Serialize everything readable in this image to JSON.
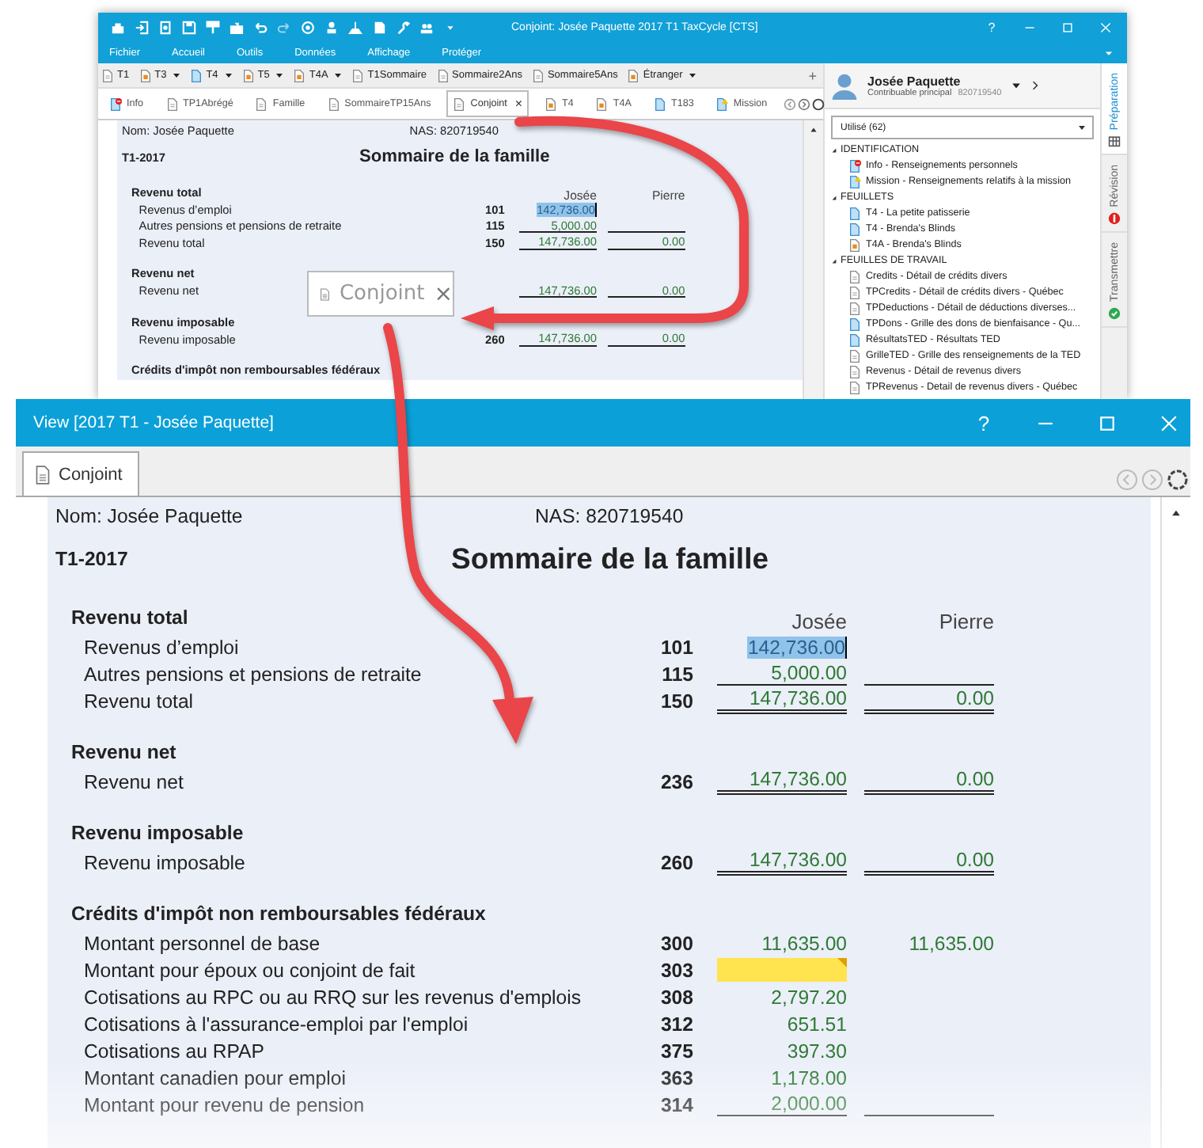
{
  "back_window": {
    "title": "Conjoint: Josée Paquette 2017 T1 TaxCycle [CTS]",
    "help": "?",
    "menu": [
      "Fichier",
      "Accueil",
      "Outils",
      "Données",
      "Affichage",
      "Protéger"
    ],
    "doc_tabs": [
      {
        "label": "T1",
        "kind": "plain",
        "dropdown": false
      },
      {
        "label": "T3",
        "kind": "orange",
        "dropdown": true
      },
      {
        "label": "T4",
        "kind": "blue",
        "dropdown": true
      },
      {
        "label": "T5",
        "kind": "orange",
        "dropdown": true
      },
      {
        "label": "T4A",
        "kind": "orange",
        "dropdown": true
      },
      {
        "label": "T1Sommaire",
        "kind": "plain",
        "dropdown": false
      },
      {
        "label": "Sommaire2Ans",
        "kind": "plain",
        "dropdown": false
      },
      {
        "label": "Sommaire5Ans",
        "kind": "plain",
        "dropdown": false
      },
      {
        "label": "Étranger",
        "kind": "orange",
        "dropdown": true
      }
    ],
    "add_tab": "+",
    "form_tabs": [
      {
        "label": "Info",
        "kind": "error",
        "selected": false
      },
      {
        "label": "TP1Abrégé",
        "kind": "plain",
        "selected": false
      },
      {
        "label": "Famille",
        "kind": "plain",
        "selected": false
      },
      {
        "label": "SommaireTP15Ans",
        "kind": "plain",
        "selected": false
      },
      {
        "label": "Conjoint",
        "kind": "plain",
        "selected": true,
        "close": "×"
      },
      {
        "label": "T4",
        "kind": "orange",
        "selected": false
      },
      {
        "label": "T4A",
        "kind": "orange",
        "selected": false
      },
      {
        "label": "T183",
        "kind": "blue",
        "selected": false
      },
      {
        "label": "Mission",
        "kind": "warning",
        "selected": false
      }
    ],
    "form": {
      "name": "Nom: Josée Paquette",
      "sin": "NAS: 820719540",
      "year": "T1-2017",
      "title": "Sommaire de la famille",
      "rows": [
        {
          "kind": "section",
          "label": "Revenu total",
          "columns": [
            "Josée",
            "Pierre"
          ]
        },
        {
          "kind": "line",
          "label": "Revenus d’emploi",
          "code": "101",
          "josee": "142,736.00",
          "underlined": false,
          "selected": true,
          "flagged": false
        },
        {
          "kind": "line",
          "label": "Autres pensions et pensions de retraite",
          "code": "115",
          "josee": "5,000.00",
          "underlined": true,
          "selected": false,
          "flagged": false
        },
        {
          "kind": "line",
          "label": "Revenu total",
          "code": "150",
          "josee": "147,736.00",
          "pierre": "0.00",
          "double": true,
          "selected": false,
          "flagged": false
        },
        {
          "kind": "section",
          "label": "Revenu net"
        },
        {
          "kind": "line",
          "label": "Revenu net",
          "josee": "147,736.00",
          "pierre": "0.00",
          "double": true,
          "selected": false,
          "flagged": false
        },
        {
          "kind": "section",
          "label": "Revenu imposable"
        },
        {
          "kind": "line",
          "label": "Revenu imposable",
          "code": "260",
          "josee": "147,736.00",
          "pierre": "0.00",
          "double": true,
          "selected": false,
          "flagged": false
        },
        {
          "kind": "section",
          "label": "Crédits d'impôt non remboursables fédéraux"
        }
      ]
    }
  },
  "side_panel": {
    "name": "Josée Paquette",
    "role": "Contribuable principal",
    "sin": "820719540",
    "filter": "Utilisé (62)",
    "tree": [
      {
        "label": "IDENTIFICATION",
        "expanded": true,
        "children": [
          {
            "label": "Info - Renseignements personnels",
            "kind": "error"
          },
          {
            "label": "Mission - Renseignements relatifs à la mission",
            "kind": "warning"
          }
        ]
      },
      {
        "label": "FEUILLETS",
        "expanded": true,
        "children": [
          {
            "label": "T4 - La petite patisserie",
            "kind": "blue"
          },
          {
            "label": "T4 - Brenda's Blinds",
            "kind": "blue"
          },
          {
            "label": "T4A - Brenda's Blinds",
            "kind": "orange"
          }
        ]
      },
      {
        "label": "FEUILLES DE TRAVAIL",
        "expanded": true,
        "children": [
          {
            "label": "Credits - Détail de crédits divers",
            "kind": "plain"
          },
          {
            "label": "TPCredits - Détail de crédits divers - Québec",
            "kind": "plain"
          },
          {
            "label": "TPDeductions - Détail de déductions diverses...",
            "kind": "plain"
          },
          {
            "label": "TPDons - Grille des dons de bienfaisance - Qu...",
            "kind": "blue"
          },
          {
            "label": "RésultatsTED - Résultats TED",
            "kind": "blue"
          },
          {
            "label": "GrilleTED - Grille des renseignements de la TED",
            "kind": "plain"
          },
          {
            "label": "Revenus - Détail de revenus divers",
            "kind": "plain"
          },
          {
            "label": "TPRevenus - Detail de revenus divers - Québec",
            "kind": "plain"
          }
        ]
      }
    ],
    "vertical_tabs": [
      {
        "label": "Préparation",
        "kind": "grid",
        "selected": true
      },
      {
        "label": "Révision",
        "kind": "error",
        "selected": false
      },
      {
        "label": "Transmettre",
        "kind": "ok",
        "selected": false
      }
    ]
  },
  "drag_tab": {
    "label": "Conjoint",
    "close": "×"
  },
  "front_window": {
    "title": "View [2017 T1 - Josée Paquette]",
    "help": "?",
    "tabs": [
      {
        "label": "Conjoint",
        "selected": true
      }
    ],
    "form": {
      "name": "Nom: Josée Paquette",
      "sin": "NAS: 820719540",
      "year": "T1-2017",
      "title": "Sommaire de la famille",
      "rows": [
        {
          "kind": "section",
          "label": "Revenu total",
          "columns": [
            "Josée",
            "Pierre"
          ]
        },
        {
          "kind": "line",
          "label": "Revenus d’emploi",
          "code": "101",
          "josee": "142,736.00",
          "underlined": false,
          "selected": true,
          "flagged": false
        },
        {
          "kind": "line",
          "label": "Autres pensions et pensions de retraite",
          "code": "115",
          "josee": "5,000.00",
          "underlined": true,
          "selected": false,
          "flagged": false
        },
        {
          "kind": "line",
          "label": "Revenu total",
          "code": "150",
          "josee": "147,736.00",
          "pierre": "0.00",
          "double": true,
          "selected": false,
          "flagged": false
        },
        {
          "kind": "section",
          "label": "Revenu net"
        },
        {
          "kind": "line",
          "label": "Revenu net",
          "code": "236",
          "josee": "147,736.00",
          "pierre": "0.00",
          "double": true,
          "selected": false,
          "flagged": false
        },
        {
          "kind": "section",
          "label": "Revenu imposable"
        },
        {
          "kind": "line",
          "label": "Revenu imposable",
          "code": "260",
          "josee": "147,736.00",
          "pierre": "0.00",
          "double": true,
          "selected": false,
          "flagged": false
        },
        {
          "kind": "section",
          "label": "Crédits d'impôt non remboursables fédéraux"
        },
        {
          "kind": "line",
          "label": "Montant personnel de base",
          "code": "300",
          "josee": "11,635.00",
          "pierre": "11,635.00",
          "underlined": false,
          "selected": false,
          "flagged": false
        },
        {
          "kind": "line",
          "label": "Montant pour époux ou conjoint de fait",
          "code": "303",
          "underlined": false,
          "selected": false,
          "flagged": true
        },
        {
          "kind": "line",
          "label": "Cotisations au RPC ou au RRQ sur les revenus d'emplois",
          "code": "308",
          "josee": "2,797.20",
          "underlined": false,
          "selected": false,
          "flagged": false
        },
        {
          "kind": "line",
          "label": "Cotisations à l'assurance-emploi par l'emploi",
          "code": "312",
          "josee": "651.51",
          "underlined": false,
          "selected": false,
          "flagged": false
        },
        {
          "kind": "line",
          "label": "Cotisations au RPAP",
          "code": "375",
          "josee": "397.30",
          "underlined": false,
          "selected": false,
          "flagged": false
        },
        {
          "kind": "line",
          "label": "Montant canadien pour emploi",
          "code": "363",
          "josee": "1,178.00",
          "underlined": false,
          "selected": false,
          "flagged": false
        },
        {
          "kind": "line",
          "label": "Montant pour revenu de pension",
          "code": "314",
          "josee": "2,000.00",
          "underlined": true,
          "selected": false,
          "flagged": false
        }
      ]
    }
  }
}
